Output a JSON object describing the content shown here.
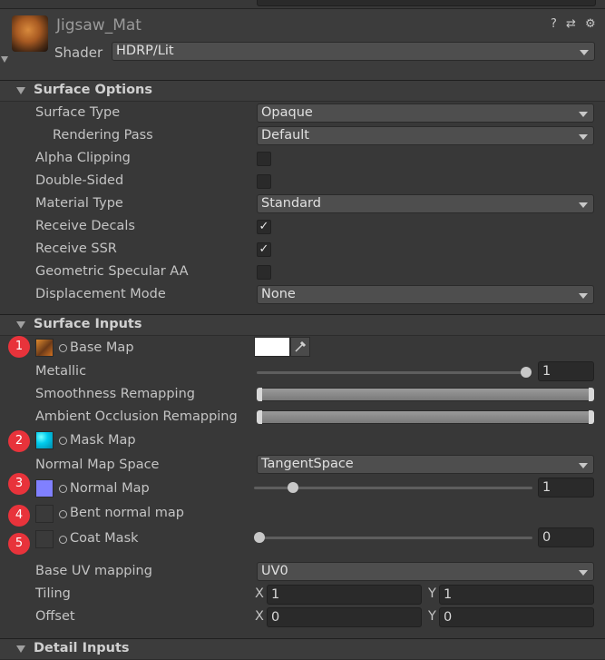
{
  "material": {
    "name": "Jigsaw_Mat",
    "shader_label": "Shader",
    "shader_value": "HDRP/Lit",
    "header_icons": "? ⇄ ⚙"
  },
  "surface_options": {
    "title": "Surface Options",
    "surface_type": {
      "label": "Surface Type",
      "value": "Opaque"
    },
    "rendering_pass": {
      "label": "Rendering Pass",
      "value": "Default"
    },
    "alpha_clipping": {
      "label": "Alpha Clipping",
      "checked": false
    },
    "double_sided": {
      "label": "Double-Sided",
      "checked": false
    },
    "material_type": {
      "label": "Material Type",
      "value": "Standard"
    },
    "receive_decals": {
      "label": "Receive Decals",
      "checked": true,
      "mark": "✓"
    },
    "receive_ssr": {
      "label": "Receive SSR",
      "checked": true,
      "mark": "✓"
    },
    "geometric_specular_aa": {
      "label": "Geometric Specular AA",
      "checked": false
    },
    "displacement_mode": {
      "label": "Displacement Mode",
      "value": "None"
    }
  },
  "surface_inputs": {
    "title": "Surface Inputs",
    "base_map": {
      "badge": "1",
      "label": "Base Map",
      "color": "#ffffff"
    },
    "metallic": {
      "label": "Metallic",
      "value": "1",
      "slider_fraction": 1.0
    },
    "smoothness_remapping": {
      "label": "Smoothness Remapping",
      "range": [
        0,
        1
      ]
    },
    "ao_remapping": {
      "label": "Ambient Occlusion Remapping",
      "range": [
        0,
        1
      ]
    },
    "mask_map": {
      "badge": "2",
      "label": "Mask Map"
    },
    "normal_map_space": {
      "label": "Normal Map Space",
      "value": "TangentSpace"
    },
    "normal_map": {
      "badge": "3",
      "label": "Normal Map",
      "value": "1",
      "slider_fraction": 0.125
    },
    "bent_normal_map": {
      "badge": "4",
      "label": "Bent normal map"
    },
    "coat_mask": {
      "badge": "5",
      "label": "Coat Mask",
      "value": "0",
      "slider_fraction": 0.0
    },
    "base_uv_mapping": {
      "label": "Base UV mapping",
      "value": "UV0"
    },
    "tiling": {
      "label": "Tiling",
      "x_label": "X",
      "x": "1",
      "y_label": "Y",
      "y": "1"
    },
    "offset": {
      "label": "Offset",
      "x_label": "X",
      "x": "0",
      "y_label": "Y",
      "y": "0"
    }
  },
  "detail_inputs": {
    "title": "Detail Inputs"
  },
  "colors": {
    "badge": "#e8333b",
    "panel": "#383838",
    "header": "#3c3c3c",
    "field": "#2a2a2a",
    "dropdown": "#4e4e4e"
  }
}
